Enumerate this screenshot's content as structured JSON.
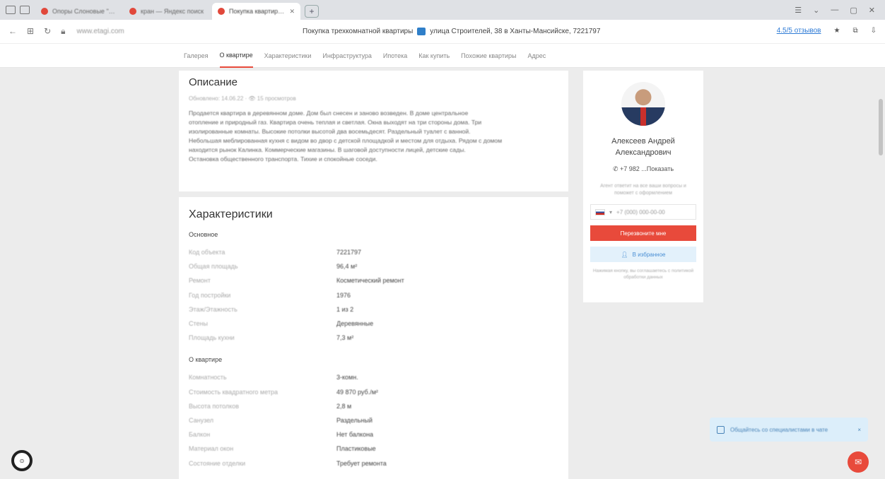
{
  "browser": {
    "tabs": [
      {
        "title": "Опоры Слоновые \"4 ...",
        "color": "#e1483b",
        "active": false
      },
      {
        "title": "кран — Яндекс поиск",
        "color": "#e1483b",
        "active": false
      },
      {
        "title": "Покупка квартиры / ...",
        "color": "#e1483b",
        "active": true
      }
    ],
    "new_tab": "+",
    "address_domain": "www.etagi.com",
    "page_title": "Покупка трехкомнатной квартиры",
    "page_address": "улица Строителей, 38 в Ханты-Мансийске, 7221797",
    "rating": "4.5/5 отзывов",
    "win_controls": [
      "☰",
      "⌄",
      "—",
      "▢",
      "✕"
    ]
  },
  "subnav": {
    "items": [
      "Галерея",
      "О квартире",
      "Характеристики",
      "Инфраструктура",
      "Ипотека",
      "Как купить",
      "Похожие квартиры",
      "Адрес"
    ],
    "active_index": 1
  },
  "description": {
    "title": "Описание",
    "meta": "Обновлено: 14.06.22 · 👁 15 просмотров",
    "lines": [
      "Продается квартира в деревянном доме. Дом был снесен и заново возведен. В доме центральное",
      "отопление и природный газ. Квартира очень теплая и светлая. Окна выходят на три стороны дома. Три",
      "изолированные комнаты. Высокие потолки высотой два восемьдесят. Раздельный туалет с ванной.",
      "Небольшая меблированная кухня с видом во двор с детской площадкой и местом для отдыха. Рядом с домом",
      "находится рынок Калинка. Коммерческие магазины. В шаговой доступности лицей, детские сады.",
      "Остановка общественного транспорта. Тихие и спокойные соседи."
    ]
  },
  "characteristics": {
    "title": "Характеристики",
    "groups": [
      {
        "title": "Основное",
        "rows": [
          {
            "k": "Код объекта",
            "v": "7221797"
          },
          {
            "k": "Общая площадь",
            "v": "96,4 м²"
          },
          {
            "k": "Ремонт",
            "v": "Косметический ремонт"
          },
          {
            "k": "Год постройки",
            "v": "1976"
          },
          {
            "k": "Этаж/Этажность",
            "v": "1 из 2"
          },
          {
            "k": "Стены",
            "v": "Деревянные"
          },
          {
            "k": "Площадь кухни",
            "v": "7,3 м²"
          }
        ]
      },
      {
        "title": "О квартире",
        "rows": [
          {
            "k": "Комнатность",
            "v": "3-комн."
          },
          {
            "k": "Стоимость квадратного метра",
            "v": "49 870 руб./м²"
          },
          {
            "k": "Высота потолков",
            "v": "2,8 м"
          },
          {
            "k": "Санузел",
            "v": "Раздельный"
          },
          {
            "k": "Балкон",
            "v": "Нет балкона"
          },
          {
            "k": "Материал окон",
            "v": "Пластиковые"
          },
          {
            "k": "Состояние отделки",
            "v": "Требует ремонта"
          }
        ]
      }
    ]
  },
  "agent": {
    "name_line1": "Алексеев Андрей",
    "name_line2": "Александрович",
    "phone": "+7 982 ...Показать",
    "note": "Агент ответит на все ваши вопросы и поможет с оформлением",
    "phone_placeholder": "+7 (000) 000-00-00",
    "call_button": "Перезвоните мне",
    "fav_button": "В избранное",
    "footer": "Нажимая кнопку, вы соглашаетесь с политикой обработки данных"
  },
  "chat": {
    "text": "Общайтесь со специалистами в чате",
    "close": "×",
    "fab": "✉"
  },
  "circle_button": "⊙"
}
